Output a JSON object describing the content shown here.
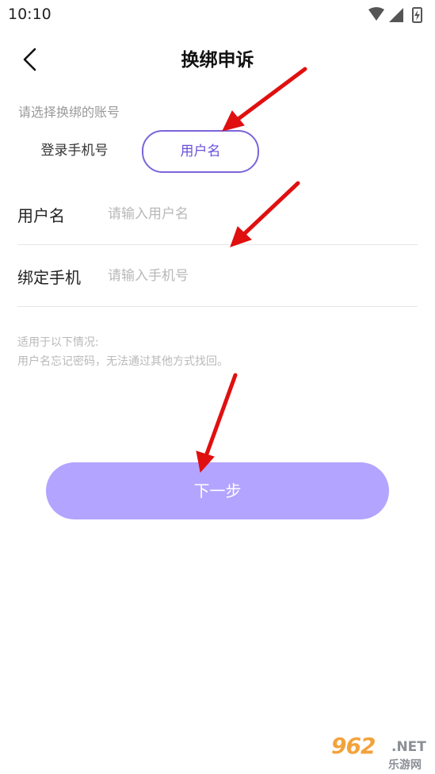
{
  "status_bar": {
    "time": "10:10"
  },
  "header": {
    "title": "换绑申诉"
  },
  "account_type": {
    "label": "请选择换绑的账号",
    "options": [
      "登录手机号",
      "用户名"
    ],
    "selected": "用户名"
  },
  "form": {
    "username": {
      "label": "用户名",
      "placeholder": "请输入用户名"
    },
    "phone": {
      "label": "绑定手机",
      "placeholder": "请输入手机号"
    }
  },
  "note": {
    "line1": "适用于以下情况:",
    "line2": "用户名忘记密码，无法通过其他方式找回。"
  },
  "next_button": {
    "label": "下一步"
  },
  "watermark": {
    "main": "962",
    "net": ".NET",
    "cn": "乐游网"
  },
  "colors": {
    "accent": "#7c64da",
    "button_bg": "#b3a4ff",
    "annotation_arrow": "#e01010"
  },
  "icons": [
    "back-arrow-icon",
    "wifi-icon",
    "signal-icon",
    "battery-icon"
  ]
}
